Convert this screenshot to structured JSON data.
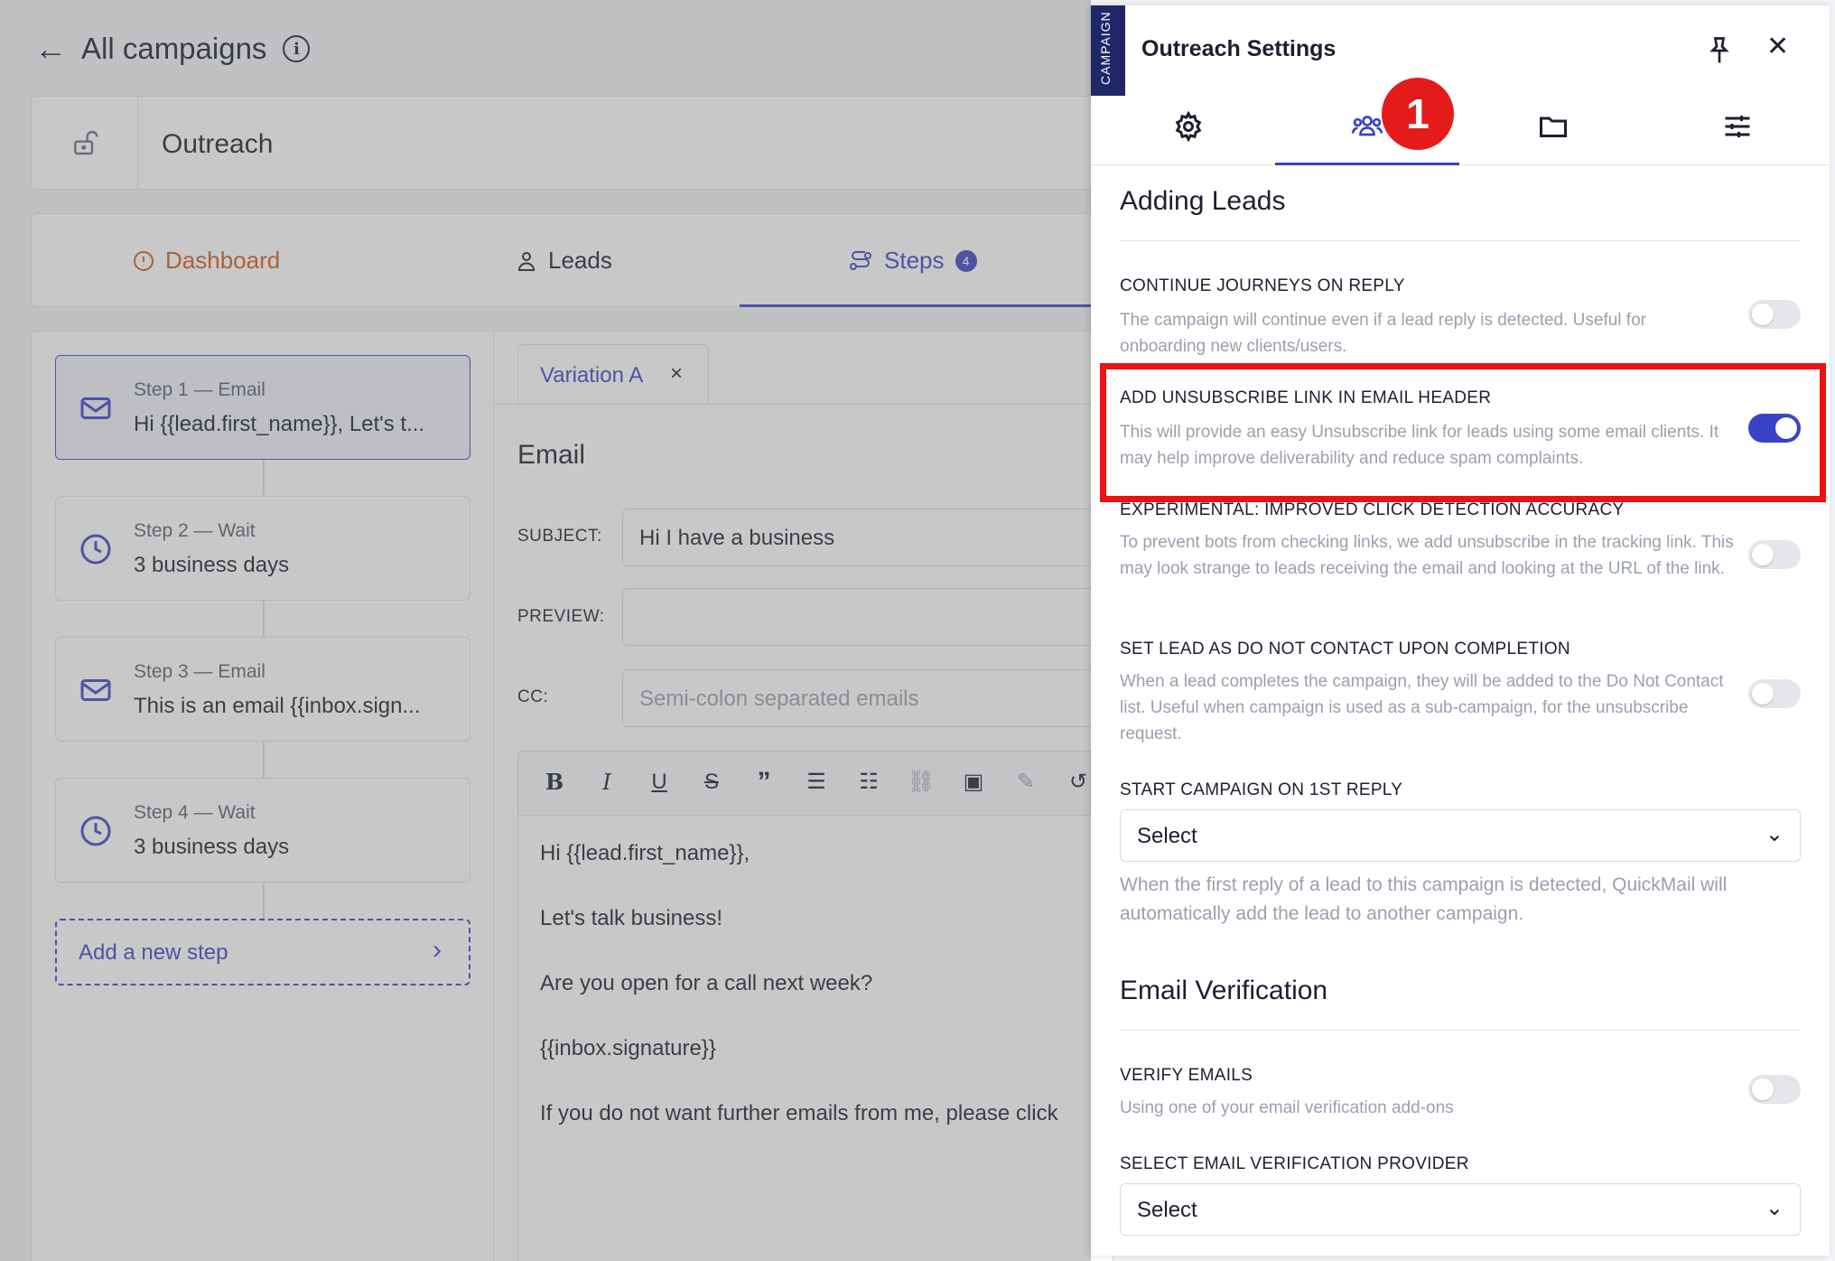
{
  "header": {
    "title": "All campaigns"
  },
  "campaign": {
    "name": "Outreach"
  },
  "main_tabs": [
    {
      "label": "Dashboard",
      "color": "#d05a1c"
    },
    {
      "label": "Leads",
      "color": "#1b1f2e"
    },
    {
      "label": "Steps",
      "color": "#3a43c7",
      "count": "4"
    }
  ],
  "steps": [
    {
      "label": "Step 1 — Email",
      "value": "Hi {{lead.first_name}}, Let's t...",
      "icon": "mail-icon"
    },
    {
      "label": "Step 2 — Wait",
      "value": "3 business days",
      "icon": "clock-icon"
    },
    {
      "label": "Step 3 — Email",
      "value": "This is an email {{inbox.sign...",
      "icon": "mail-icon"
    },
    {
      "label": "Step 4 — Wait",
      "value": "3 business days",
      "icon": "clock-icon"
    }
  ],
  "add_step": {
    "label": "Add a new step"
  },
  "editor": {
    "variation_tab": "Variation A",
    "heading": "Email",
    "subject_label": "SUBJECT:",
    "subject_value": "Hi I have a business",
    "preview_label": "PREVIEW:",
    "preview_value": "",
    "cc_label": "CC:",
    "cc_placeholder": "Semi-colon separated emails",
    "body": [
      "Hi {{lead.first_name}},",
      "Let's talk business!",
      "Are you open for a call next week?",
      "{{inbox.signature}}",
      "If you do not want further emails from me, please click"
    ]
  },
  "panel": {
    "ribbon": "CAMPAIGN",
    "title": "Outreach Settings",
    "marker": "1",
    "tabs": [
      "gear-icon",
      "users-icon",
      "folder-icon",
      "sliders-icon"
    ],
    "active_tab": 1,
    "adding_leads": {
      "heading": "Adding Leads",
      "settings": [
        {
          "title": "CONTINUE JOURNEYS ON REPLY",
          "desc": "The campaign will continue even if a lead reply is detected. Useful for onboarding new clients/users.",
          "on": false
        },
        {
          "title": "ADD UNSUBSCRIBE LINK IN EMAIL HEADER",
          "desc": "This will provide an easy Unsubscribe link for leads using some email clients. It may help improve deliverability and reduce spam complaints.",
          "on": true
        },
        {
          "title": "EXPERIMENTAL: IMPROVED CLICK DETECTION ACCURACY",
          "desc": "To prevent bots from checking links, we add unsubscribe in the tracking link. This may look strange to leads receiving the email and looking at the URL of the link.",
          "on": false
        },
        {
          "title": "SET LEAD AS DO NOT CONTACT UPON COMPLETION",
          "desc": "When a lead completes the campaign, they will be added to the Do Not Contact list. Useful when campaign is used as a sub-campaign, for the unsubscribe request.",
          "on": false
        }
      ],
      "start_on_reply": {
        "title": "START CAMPAIGN ON 1ST REPLY",
        "value": "Select",
        "help": "When the first reply of a lead to this campaign is detected, QuickMail will automatically add the lead to another campaign."
      }
    },
    "email_verification": {
      "heading": "Email Verification",
      "verify": {
        "title": "VERIFY EMAILS",
        "desc": "Using one of your email verification add-ons",
        "on": false
      },
      "provider": {
        "title": "SELECT EMAIL VERIFICATION PROVIDER",
        "value": "Select"
      }
    }
  },
  "colors": {
    "accent": "#3a43c7",
    "highlight": "#ef1010",
    "ribbon": "#1f2768"
  }
}
